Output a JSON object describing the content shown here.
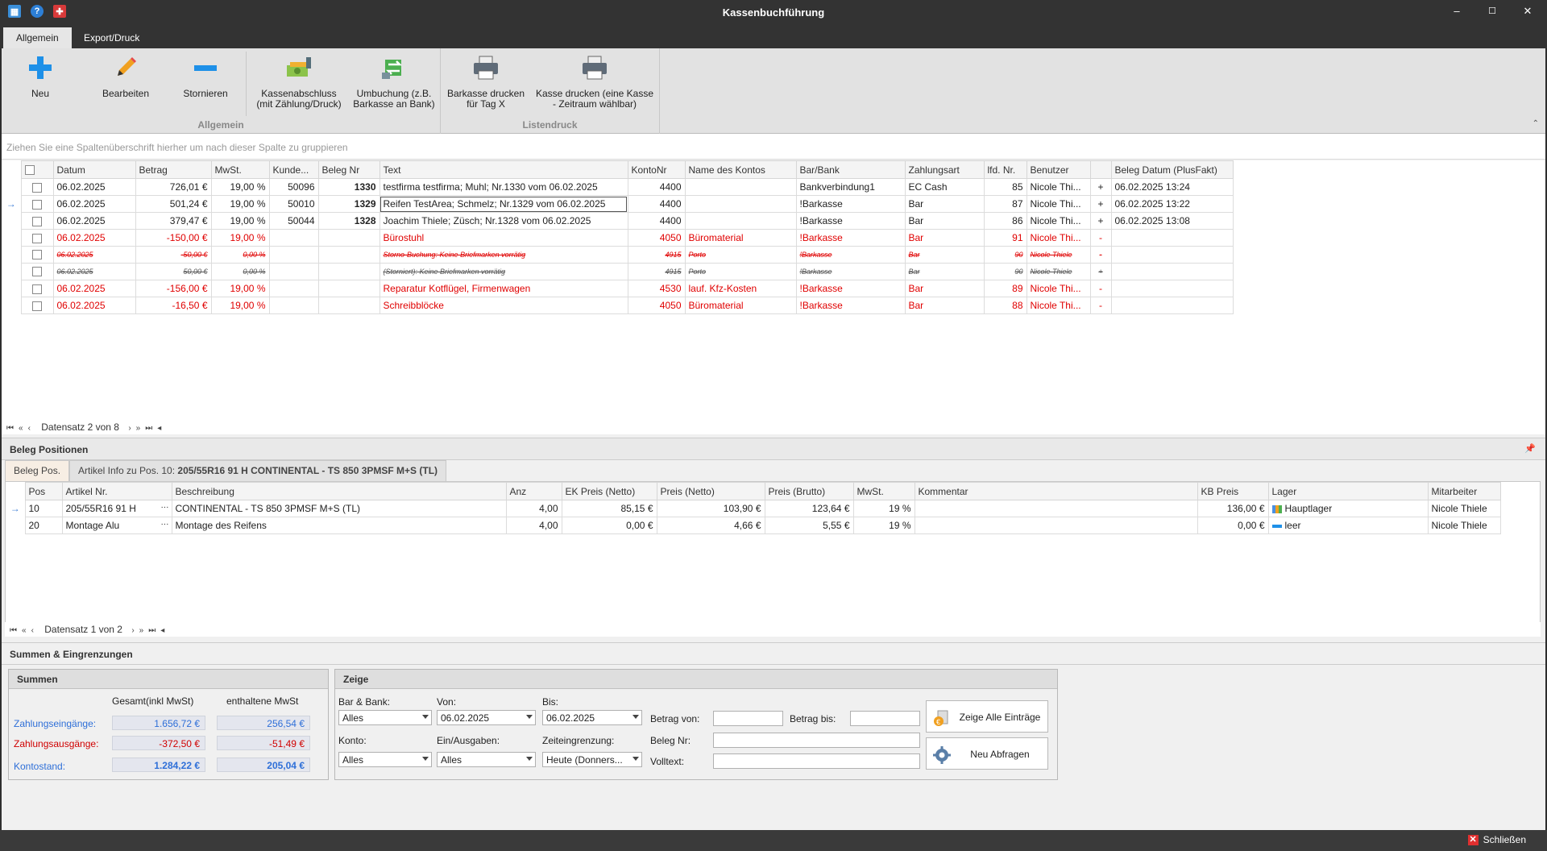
{
  "window": {
    "title": "Kassenbuchführung",
    "minimize": "–",
    "maximize": "☐",
    "close": "✕"
  },
  "tabs": [
    {
      "label": "Allgemein"
    },
    {
      "label": "Export/Druck"
    }
  ],
  "ribbon": {
    "groups": [
      {
        "caption": "Allgemein"
      },
      {
        "caption": "Listendruck"
      }
    ],
    "buttons": {
      "neu": "Neu",
      "bearbeiten": "Bearbeiten",
      "stornieren": "Stornieren",
      "kassenabschluss_1": "Kassenabschluss",
      "kassenabschluss_2": "(mit Zählung/Druck)",
      "umbuchung_1": "Umbuchung (z.B.",
      "umbuchung_2": "Barkasse an Bank)",
      "barkasse_1": "Barkasse drucken",
      "barkasse_2": "für Tag X",
      "kasse_1": "Kasse drucken (eine Kasse",
      "kasse_2": "- Zeitraum wählbar)"
    }
  },
  "group_panel": "Ziehen Sie eine Spaltenüberschrift hierher um nach dieser Spalte zu gruppieren",
  "bookings": {
    "columns": [
      "Datum",
      "Betrag",
      "MwSt.",
      "Kunde...",
      "Beleg Nr",
      "Text",
      "KontoNr",
      "Name des Kontos",
      "Bar/Bank",
      "Zahlungsart",
      "lfd. Nr.",
      "Benutzer",
      "",
      "Beleg Datum (PlusFakt)"
    ],
    "rows": [
      [
        "06.02.2025",
        "726,01 €",
        "19,00 %",
        "50096",
        "1330",
        "testfirma testfirma; Muhl; Nr.1330 vom 06.02.2025",
        "4400",
        "",
        "Bankverbindung1",
        "EC Cash",
        "85",
        "Nicole Thi...",
        "+",
        "06.02.2025 13:24"
      ],
      [
        "06.02.2025",
        "501,24 €",
        "19,00 %",
        "50010",
        "1329",
        "Reifen TestArea; Schmelz; Nr.1329 vom 06.02.2025",
        "4400",
        "",
        "!Barkasse",
        "Bar",
        "87",
        "Nicole Thi...",
        "+",
        "06.02.2025 13:22"
      ],
      [
        "06.02.2025",
        "379,47 €",
        "19,00 %",
        "50044",
        "1328",
        "Joachim Thiele; Züsch; Nr.1328 vom 06.02.2025",
        "4400",
        "",
        "!Barkasse",
        "Bar",
        "86",
        "Nicole Thi...",
        "+",
        "06.02.2025 13:08"
      ],
      [
        "06.02.2025",
        "-150,00 €",
        "19,00 %",
        "",
        "",
        "Bürostuhl",
        "4050",
        "Büromaterial",
        "!Barkasse",
        "Bar",
        "91",
        "Nicole Thi...",
        "-",
        ""
      ],
      [
        "06.02.2025",
        "-50,00 €",
        "0,00 %",
        "",
        "",
        "Storno-Buchung: Keine Briefmarken vorrätig",
        "4915",
        "Porto",
        "!Barkasse",
        "Bar",
        "90",
        "Nicole Thiele",
        "-",
        ""
      ],
      [
        "06.02.2025",
        "50,00 €",
        "0,00 %",
        "",
        "",
        "(Storniert): Keine Briefmarken vorrätig",
        "4915",
        "Porto",
        "!Barkasse",
        "Bar",
        "90",
        "Nicole Thiele",
        "+",
        ""
      ],
      [
        "06.02.2025",
        "-156,00 €",
        "19,00 %",
        "",
        "",
        "Reparatur Kotflügel, Firmenwagen",
        "4530",
        "lauf. Kfz-Kosten",
        "!Barkasse",
        "Bar",
        "89",
        "Nicole Thi...",
        "-",
        ""
      ],
      [
        "06.02.2025",
        "-16,50 €",
        "19,00 %",
        "",
        "",
        "Schreibblöcke",
        "4050",
        "Büromaterial",
        "!Barkasse",
        "Bar",
        "88",
        "Nicole Thi...",
        "-",
        ""
      ]
    ],
    "navigator": "Datensatz 2 von 8"
  },
  "beleg": {
    "section_title": "Beleg Positionen",
    "subtabs": [
      "Beleg Pos.",
      "Artikel Info zu Pos. 10:"
    ],
    "subtab_article": "205/55R16 91 H CONTINENTAL - TS 850 3PMSF M+S (TL)",
    "columns": [
      "Pos",
      "Artikel Nr.",
      "Beschreibung",
      "Anz",
      "EK Preis (Netto)",
      "Preis (Netto)",
      "Preis (Brutto)",
      "MwSt.",
      "Kommentar",
      "KB Preis",
      "Lager",
      "Mitarbeiter"
    ],
    "rows": [
      [
        "10",
        "205/55R16 91 H",
        "CONTINENTAL - TS 850 3PMSF M+S (TL)",
        "4,00",
        "85,15 €",
        "103,90 €",
        "123,64 €",
        "19 %",
        "",
        "136,00 €",
        "Hauptlager",
        "Nicole Thiele"
      ],
      [
        "20",
        "Montage Alu",
        "Montage des Reifens",
        "4,00",
        "0,00 €",
        "4,66 €",
        "5,55 €",
        "19 %",
        "",
        "0,00 €",
        "leer",
        "Nicole Thiele"
      ]
    ],
    "navigator": "Datensatz 1 von 2"
  },
  "summen_section": "Summen & Eingrenzungen",
  "summen": {
    "title": "Summen",
    "col_total": "Gesamt(inkl MwSt)",
    "col_vat": "enthaltene MwSt",
    "rows": [
      {
        "label": "Zahlungseingänge:",
        "total": "1.656,72 €",
        "vat": "256,54 €"
      },
      {
        "label": "Zahlungsausgänge:",
        "total": "-372,50 €",
        "vat": "-51,49 €"
      },
      {
        "label": "Kontostand:",
        "total": "1.284,22 €",
        "vat": "205,04 €"
      }
    ]
  },
  "zeige": {
    "title": "Zeige",
    "bar_bank_label": "Bar & Bank:",
    "bar_bank_value": "Alles",
    "von_label": "Von:",
    "von_value": "06.02.2025",
    "bis_label": "Bis:",
    "bis_value": "06.02.2025",
    "betrag_von_label": "Betrag von:",
    "betrag_bis_label": "Betrag bis:",
    "konto_label": "Konto:",
    "konto_value": "Alles",
    "einaus_label": "Ein/Ausgaben:",
    "einaus_value": "Alles",
    "zeit_label": "Zeiteingrenzung:",
    "zeit_value": "Heute (Donners...",
    "belegnr_label": "Beleg Nr:",
    "volltext_label": "Volltext:",
    "btn_alle": "Zeige Alle Einträge",
    "btn_neu": "Neu Abfragen"
  },
  "statusbar": {
    "close": "Schließen"
  },
  "colors": {
    "accent_blue": "#2e6fd8",
    "negative_red": "#e00000",
    "title_bg": "#333333"
  }
}
